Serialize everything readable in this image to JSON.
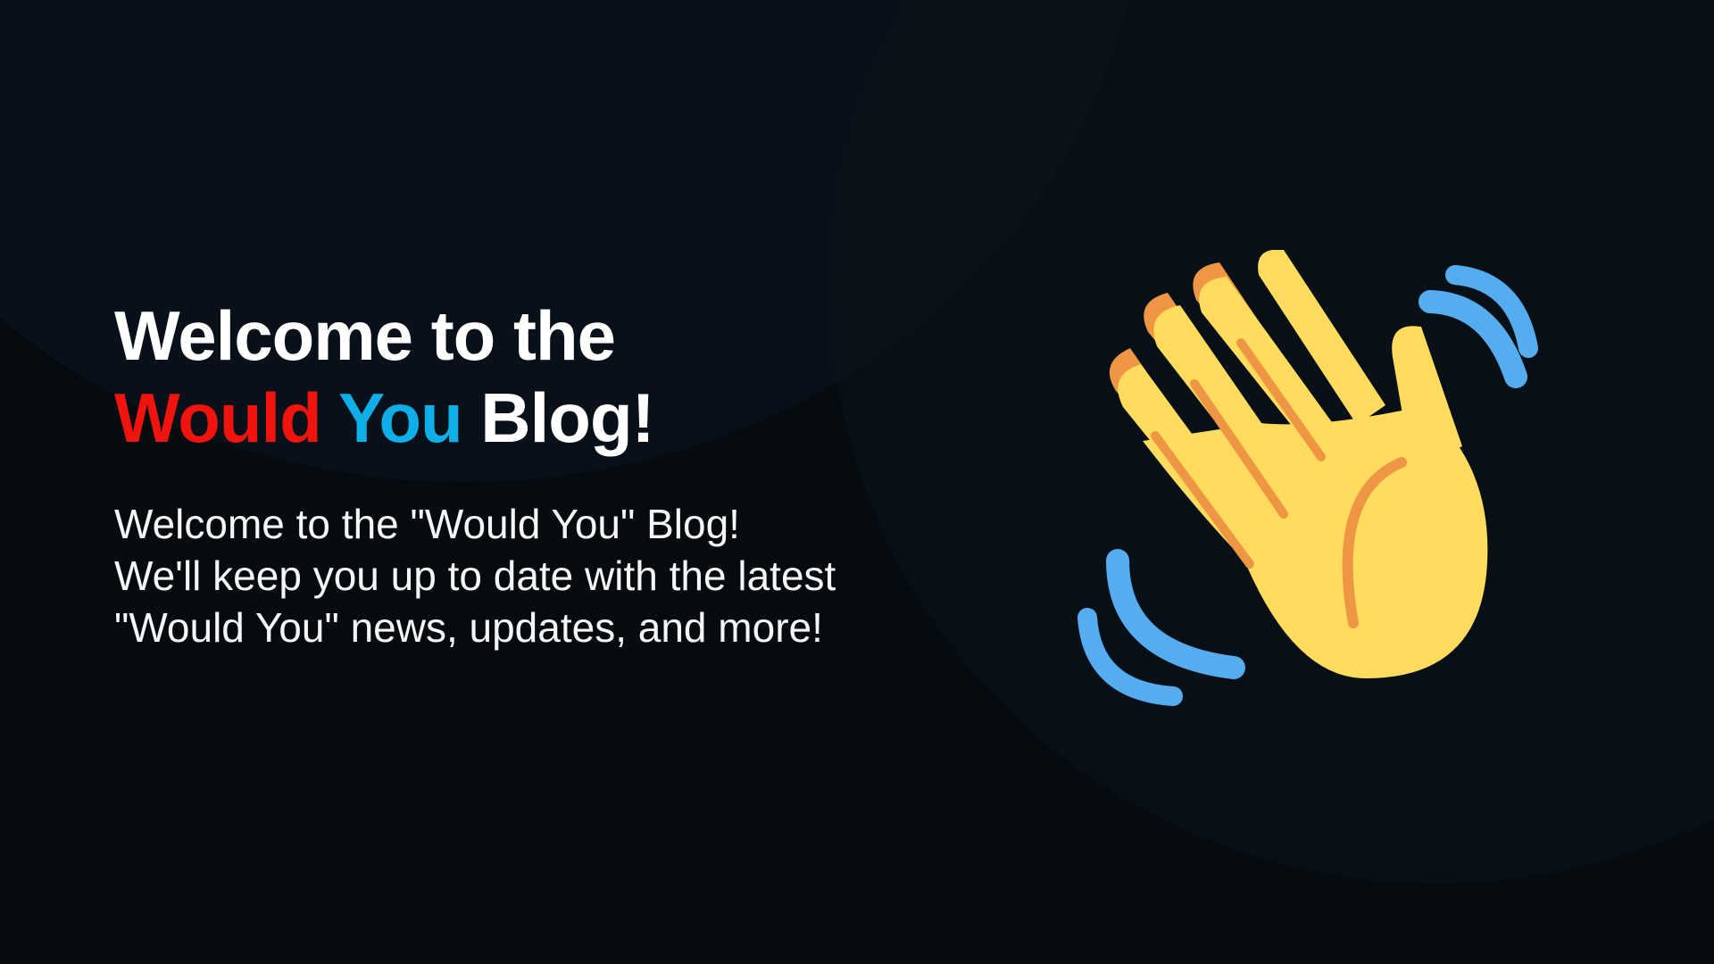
{
  "hero": {
    "title_line1": "Welcome to the",
    "title_word_red": "Would",
    "title_word_blue": "You",
    "title_word_white": "Blog!",
    "description": "Welcome to the \"Would You\" Blog! We'll keep you up to date with the latest \"Would You\" news, updates, and more!"
  },
  "icon": "waving-hand-icon",
  "colors": {
    "background": "#060b10",
    "accent_red": "#f0140f",
    "accent_blue": "#10aee8",
    "hand_yellow": "#ffdb5e",
    "hand_shade": "#ef9645",
    "motion_lines": "#55acee"
  }
}
